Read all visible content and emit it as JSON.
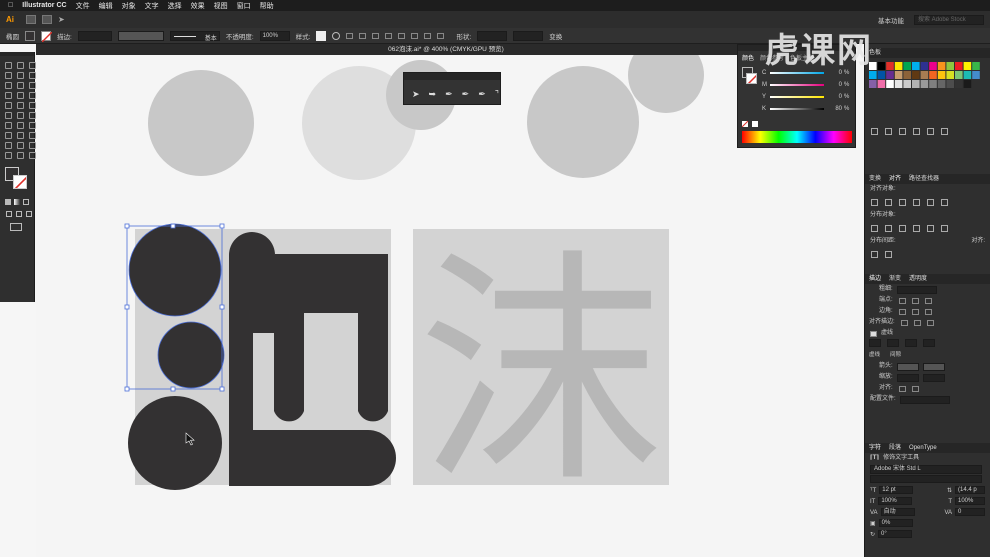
{
  "macmenu": {
    "app": "Illustrator CC",
    "items": [
      "文件",
      "编辑",
      "对象",
      "文字",
      "选择",
      "效果",
      "视图",
      "窗口",
      "帮助"
    ]
  },
  "appbar": {
    "logo": "Ai",
    "workspace": "基本功能",
    "search_placeholder": "搜索 Adobe Stock"
  },
  "control": {
    "mode_label": "椭圆",
    "stroke_label": "描边:",
    "stroke_preset": "基本",
    "opacity_label": "不透明度:",
    "opacity_value": "100%",
    "style_label": "样式:",
    "shape_label": "形状:",
    "transform_label": "变换"
  },
  "document": {
    "tab_title": "062泡沫.ai* @ 400% (CMYK/GPU 预览)"
  },
  "canvas": {
    "artwork_char": "沫"
  },
  "color_panel": {
    "tabs": [
      "颜色",
      "颜色参考",
      "色板主题"
    ],
    "channels": [
      {
        "k": "C",
        "v": "0",
        "u": "%"
      },
      {
        "k": "M",
        "v": "0",
        "u": "%"
      },
      {
        "k": "Y",
        "v": "0",
        "u": "%"
      },
      {
        "k": "K",
        "v": "80",
        "u": "%"
      }
    ]
  },
  "swatches_panel": {
    "tab": "色板"
  },
  "align_panel": {
    "tabs": [
      "变换",
      "对齐",
      "路径查找器"
    ],
    "align_objects": "对齐对象:",
    "distribute_objects": "分布对象:",
    "distribute_spacing": "分布间距:",
    "align_to": "对齐:"
  },
  "stroke_panel": {
    "tabs": [
      "描边",
      "渐变",
      "透明度"
    ],
    "weight": "粗细:",
    "cap": "端点:",
    "corner": "边角:",
    "align_stroke": "对齐描边:",
    "dashed": "虚线",
    "dash": "虚线",
    "gap": "间隙",
    "arrow_start": "箭头:",
    "scale": "缩放:",
    "align": "对齐:",
    "profile": "配置文件:"
  },
  "char_panel": {
    "tabs": [
      "字符",
      "段落",
      "OpenType"
    ],
    "touch_type": "修饰文字工具",
    "font": "Adobe 宋体 Std L",
    "size": "12 pt",
    "leading": "(14.4 p",
    "hscale": "100%",
    "vscale": "100%",
    "kern": "自动",
    "track": "0",
    "shift": "0%",
    "rotate": "0°"
  },
  "watermark": {
    "text": "虎课网"
  },
  "colors": {
    "accent_stroke": "#e0302a",
    "selection": "#4c6fd8",
    "dark_shape": "#333132",
    "light_bg": "#d3d3d3"
  }
}
